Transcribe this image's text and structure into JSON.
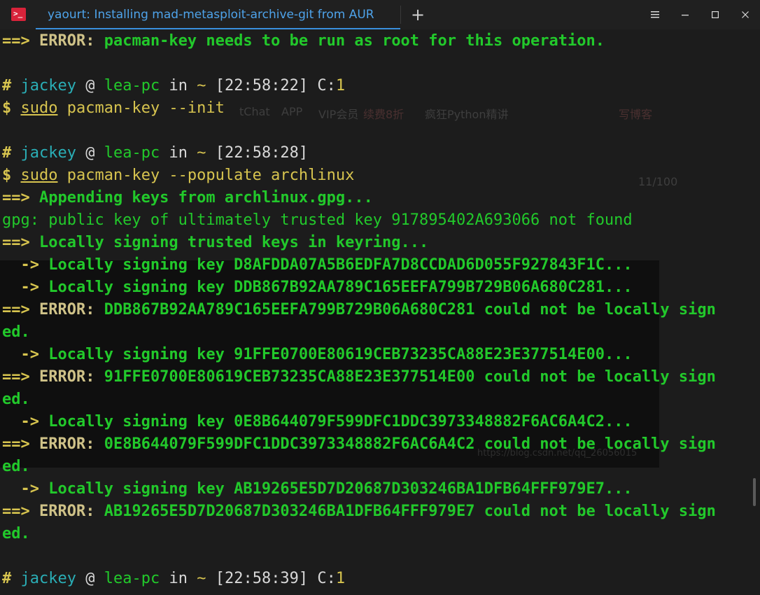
{
  "window": {
    "tab_title": "yaourt: Installing mad-metasploit-archive-git from AUR",
    "new_tab_label": "+",
    "minimize_label": "≡",
    "min_label": "–",
    "max_label": "☐",
    "close_label": "✕"
  },
  "background_ghost": {
    "app_label": "APP",
    "vip_label": "VIP会员",
    "discount_label": "续费8折",
    "course_label": "疯狂Python精讲",
    "chat_label": "tChat",
    "write_label": "写博客",
    "counter": "11/100",
    "watermark": "https://blog.csdn.net/qq_26056015"
  },
  "terminal": {
    "lines": [
      {
        "arrow": "==> ",
        "tag": "ERROR:",
        "text": " pacman-key needs to be run as root for this operation."
      },
      {
        "blank": true
      },
      {
        "prompt_hash": "#",
        "user": "jackey",
        "at": "@",
        "host": "lea-pc",
        "in": "in",
        "path": "~",
        "time": "[22:58:22]",
        "code_label": "C:",
        "code": "1"
      },
      {
        "dollar": "$",
        "sudo": "sudo",
        "cmd": "pacman-key --init"
      },
      {
        "blank": true
      },
      {
        "prompt_hash": "#",
        "user": "jackey",
        "at": "@",
        "host": "lea-pc",
        "in": "in",
        "path": "~",
        "time": "[22:58:28]"
      },
      {
        "dollar": "$",
        "sudo": "sudo",
        "cmd": "pacman-key --populate archlinux"
      },
      {
        "arrow": "==> ",
        "msg": "Appending keys from archlinux.gpg..."
      },
      {
        "plain": "gpg: public key of ultimately trusted key 917895402A693066 not found"
      },
      {
        "arrow": "==> ",
        "msg": "Locally signing trusted keys in keyring..."
      },
      {
        "sub": "  -> ",
        "msg": "Locally signing key D8AFDDA07A5B6EDFA7D8CCDAD6D055F927843F1C..."
      },
      {
        "sub": "  -> ",
        "msg": "Locally signing key DDB867B92AA789C165EEFA799B729B06A680C281..."
      },
      {
        "arrow": "==> ",
        "tag": "ERROR:",
        "text": " DDB867B92AA789C165EEFA799B729B06A680C281 could not be locally sign"
      },
      {
        "wrap": "ed."
      },
      {
        "sub": "  -> ",
        "msg": "Locally signing key 91FFE0700E80619CEB73235CA88E23E377514E00..."
      },
      {
        "arrow": "==> ",
        "tag": "ERROR:",
        "text": " 91FFE0700E80619CEB73235CA88E23E377514E00 could not be locally sign"
      },
      {
        "wrap": "ed."
      },
      {
        "sub": "  -> ",
        "msg": "Locally signing key 0E8B644079F599DFC1DDC3973348882F6AC6A4C2..."
      },
      {
        "arrow": "==> ",
        "tag": "ERROR:",
        "text": " 0E8B644079F599DFC1DDC3973348882F6AC6A4C2 could not be locally sign"
      },
      {
        "wrap": "ed."
      },
      {
        "sub": "  -> ",
        "msg": "Locally signing key AB19265E5D7D20687D303246BA1DFB64FFF979E7..."
      },
      {
        "arrow": "==> ",
        "tag": "ERROR:",
        "text": " AB19265E5D7D20687D303246BA1DFB64FFF979E7 could not be locally sign"
      },
      {
        "wrap": "ed."
      },
      {
        "blank": true
      },
      {
        "prompt_hash": "#",
        "user": "jackey",
        "at": "@",
        "host": "lea-pc",
        "in": "in",
        "path": "~",
        "time": "[22:58:39]",
        "code_label": "C:",
        "code": "1"
      }
    ]
  }
}
